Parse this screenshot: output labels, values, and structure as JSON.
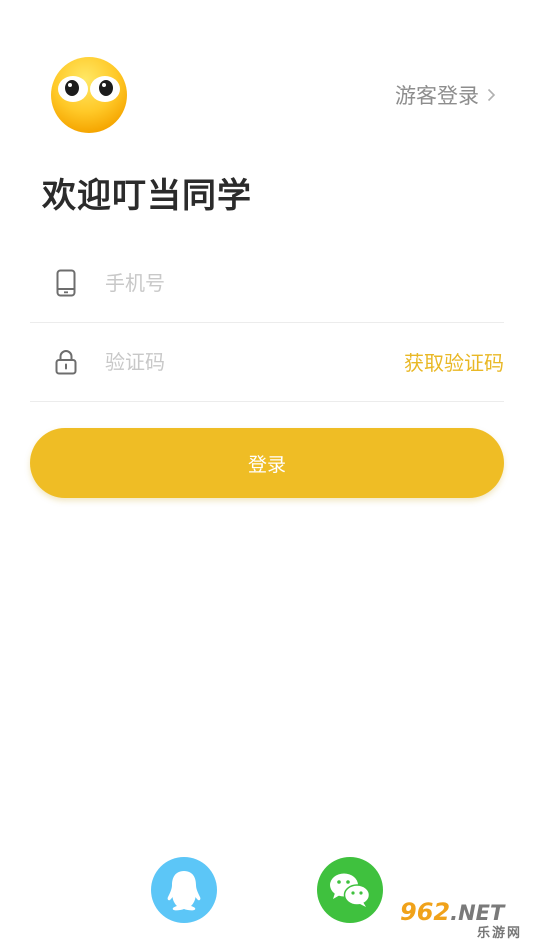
{
  "header": {
    "logo_icon": "emoji-face-icon",
    "guest_login_label": "游客登录"
  },
  "welcome": {
    "title": "欢迎叮当同学"
  },
  "form": {
    "phone_placeholder": "手机号",
    "phone_value": "",
    "code_placeholder": "验证码",
    "code_value": "",
    "get_code_label": "获取验证码",
    "login_label": "登录"
  },
  "social": {
    "qq_icon": "qq-penguin-icon",
    "wechat_icon": "wechat-icon"
  },
  "watermark": {
    "main": "962",
    "net": ".NET",
    "sub": "乐游网"
  },
  "colors": {
    "accent": "#efbd25",
    "accent_text": "#e9b826",
    "qq": "#5cc6f7",
    "wechat": "#3fc13e"
  }
}
